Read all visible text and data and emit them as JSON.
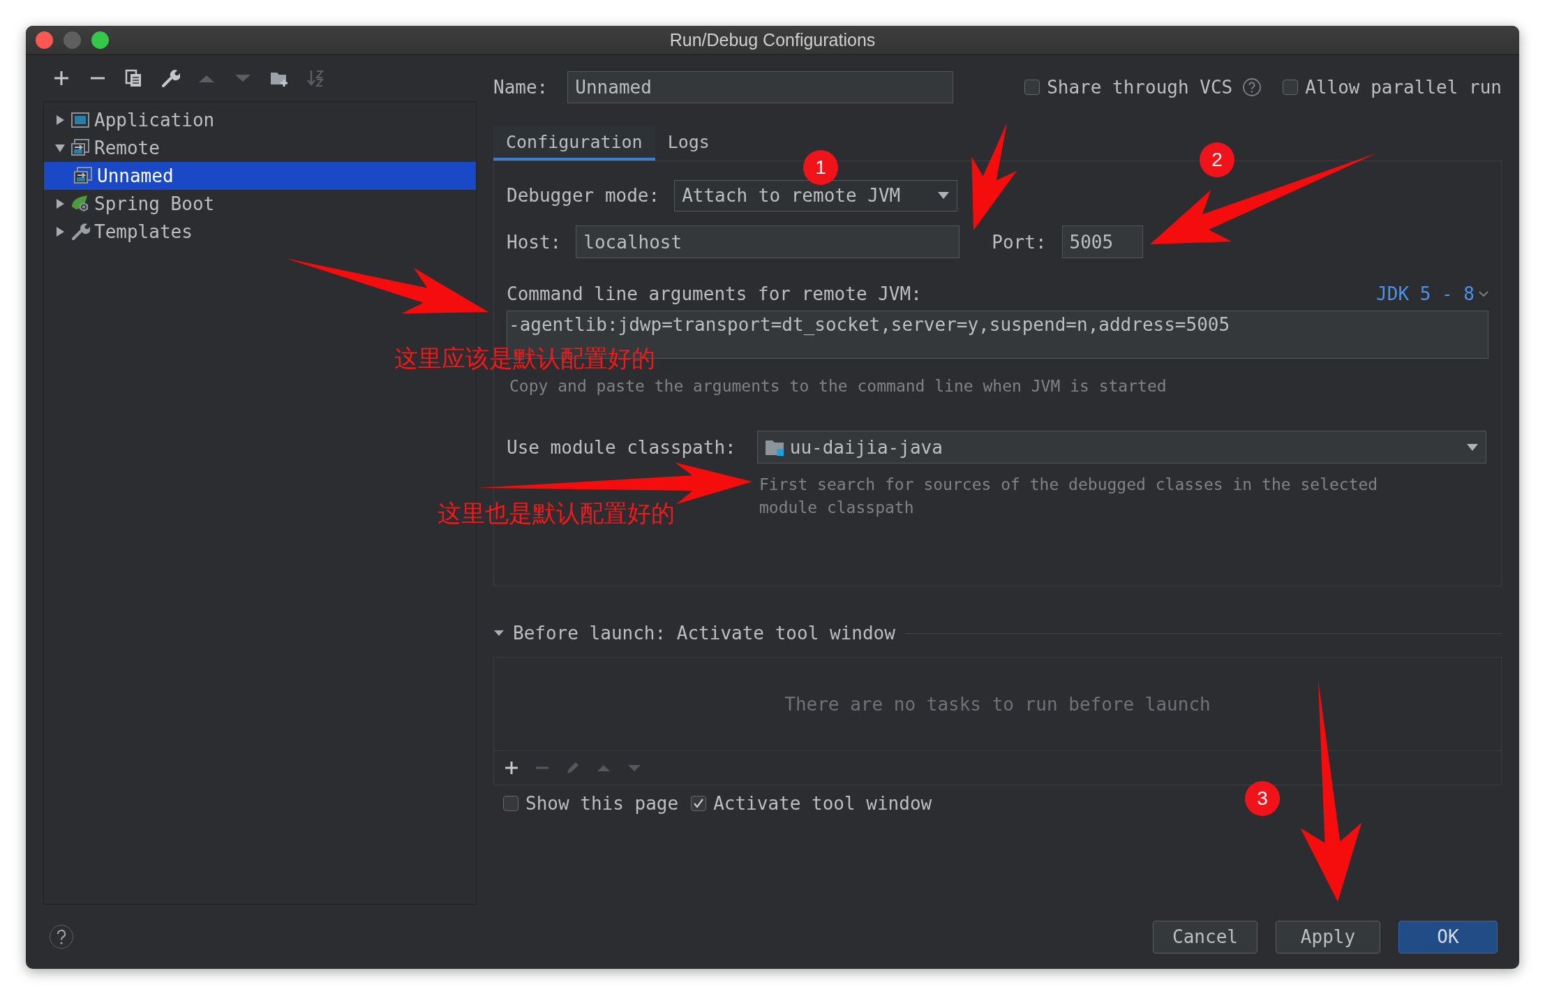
{
  "window": {
    "title": "Run/Debug Configurations"
  },
  "tree": [
    {
      "label": "Application",
      "kind": "app",
      "expanded": false,
      "selected": false
    },
    {
      "label": "Remote",
      "kind": "remote",
      "expanded": true,
      "selected": false,
      "children": [
        {
          "label": "Unnamed",
          "kind": "remote",
          "selected": true
        }
      ]
    },
    {
      "label": "Spring Boot",
      "kind": "spring",
      "expanded": false,
      "selected": false
    },
    {
      "label": "Templates",
      "kind": "templates",
      "expanded": false,
      "selected": false
    }
  ],
  "name_field": {
    "label": "Name:",
    "value": "Unnamed"
  },
  "share_vcs": {
    "label": "Share through VCS",
    "checked": false
  },
  "allow_parallel": {
    "label": "Allow parallel run",
    "checked": false
  },
  "tabs": [
    {
      "label": "Configuration",
      "selected": true
    },
    {
      "label": "Logs",
      "selected": false
    }
  ],
  "debugger_mode": {
    "label": "Debugger mode:",
    "value": "Attach to remote JVM"
  },
  "host": {
    "label": "Host:",
    "value": "localhost"
  },
  "port": {
    "label": "Port:",
    "value": "5005"
  },
  "command_line": {
    "label": "Command line arguments for remote JVM:",
    "jdk_link": "JDK 5 - 8",
    "value": "-agentlib:jdwp=transport=dt_socket,server=y,suspend=n,address=5005",
    "hint": "Copy and paste the arguments to the command line when JVM is started"
  },
  "module_classpath": {
    "label": "Use module classpath:",
    "value": "uu-daijia-java",
    "hint": "First search for sources of the debugged classes in the selected module classpath"
  },
  "before_launch": {
    "title": "Before launch: Activate tool window",
    "expanded": true,
    "empty_text": "There are no tasks to run before launch"
  },
  "show_this_page": {
    "label": "Show this page",
    "checked": false
  },
  "activate_tool_window": {
    "label": "Activate tool window",
    "checked": true
  },
  "buttons": [
    {
      "label": "Cancel",
      "kind": "normal"
    },
    {
      "label": "Apply",
      "kind": "normal"
    },
    {
      "label": "OK",
      "kind": "default"
    }
  ],
  "annotations": {
    "markers": [
      "1",
      "2",
      "3"
    ],
    "notes": [
      "这里应该是默认配置好的",
      "这里也是默认配置好的"
    ]
  }
}
